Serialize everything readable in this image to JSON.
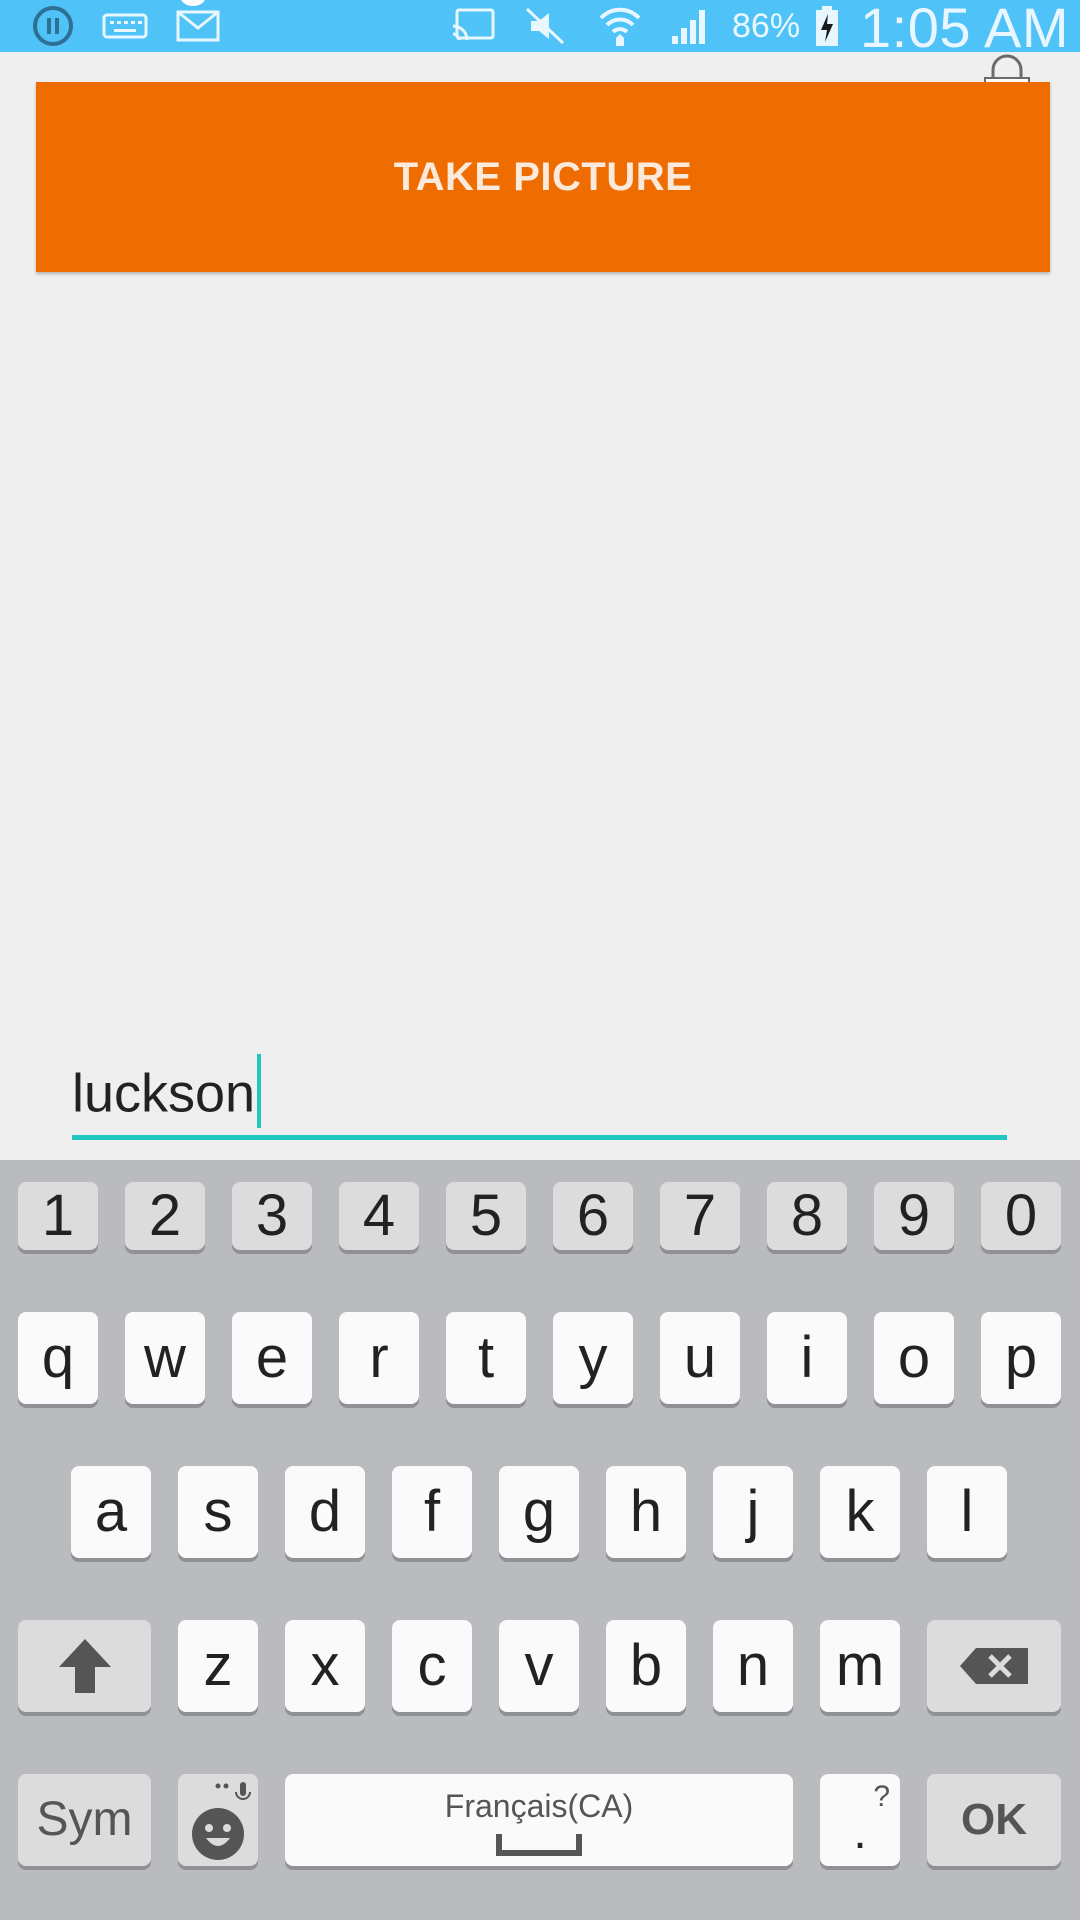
{
  "status_bar": {
    "icons_left": [
      "pause-icon",
      "keyboard-icon",
      "email-icon"
    ],
    "icons_right": [
      "cast-icon",
      "mute-icon",
      "wifi-icon",
      "signal-icon",
      "battery-charging-icon"
    ],
    "battery_percent": "86%",
    "time": "1:05 AM"
  },
  "main": {
    "take_picture_label": "TAKE PICTURE",
    "accent_color": "#ef6c00"
  },
  "name_field": {
    "value": "luckson",
    "underline_color": "#1fc7c0"
  },
  "keyboard": {
    "number_row": [
      "1",
      "2",
      "3",
      "4",
      "5",
      "6",
      "7",
      "8",
      "9",
      "0"
    ],
    "row1": [
      "q",
      "w",
      "e",
      "r",
      "t",
      "y",
      "u",
      "i",
      "o",
      "p"
    ],
    "row2": [
      "a",
      "s",
      "d",
      "f",
      "g",
      "h",
      "j",
      "k",
      "l"
    ],
    "row3": [
      "z",
      "x",
      "c",
      "v",
      "b",
      "n",
      "m"
    ],
    "sym_label": "Sym",
    "space_label": "Français(CA)",
    "period_label": ".",
    "period_extra": "?",
    "ok_label": "OK"
  }
}
